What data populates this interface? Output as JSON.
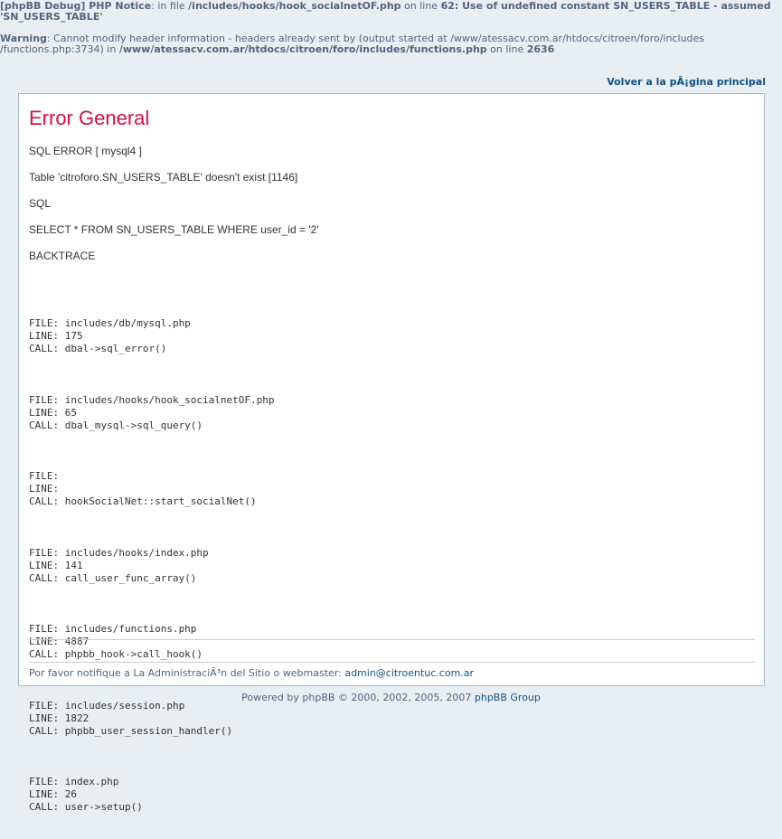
{
  "notices": {
    "debug_tag": "[phpBB Debug] PHP Notice",
    "notice1_text_a": ": in file ",
    "notice1_file": "/includes/hooks/hook_socialnetOF.php",
    "notice1_text_b": " on line ",
    "notice1_line": "62",
    "notice1_msg": ": Use of undefined constant SN_USERS_TABLE - assumed 'SN_USERS_TABLE'",
    "warning_tag": "Warning",
    "warning_text": ": Cannot modify header information - headers already sent by (output started at /www/atessacv.com.ar/htdocs/citroen/foro/includes /functions.php:3734) in ",
    "warning_file": "/www/atessacv.com.ar/htdocs/citroen/foro/includes/functions.php",
    "warning_text_b": " on line ",
    "warning_line": "2636"
  },
  "nav": {
    "home_link": "Volver a la pÃ¡gina principal"
  },
  "error": {
    "title": "Error General",
    "sql_error": "SQL ERROR [ mysql4 ]",
    "table_msg": "Table 'citroforo.SN_USERS_TABLE' doesn't exist [1146]",
    "sql_label": "SQL",
    "query": "SELECT * FROM SN_USERS_TABLE WHERE user_id = '2'",
    "backtrace_label": "BACKTRACE"
  },
  "backtrace": [
    {
      "file": "FILE: includes/db/mysql.php",
      "line": "LINE: 175",
      "call": "CALL: dbal->sql_error()"
    },
    {
      "file": "FILE: includes/hooks/hook_socialnetOF.php",
      "line": "LINE: 65",
      "call": "CALL: dbal_mysql->sql_query()"
    },
    {
      "file": "FILE:",
      "line": "LINE:",
      "call": "CALL: hookSocialNet::start_socialNet()"
    },
    {
      "file": "FILE: includes/hooks/index.php",
      "line": "LINE: 141",
      "call": "CALL: call_user_func_array()"
    },
    {
      "file": "FILE: includes/functions.php",
      "line": "LINE: 4887",
      "call": "CALL: phpbb_hook->call_hook()"
    },
    {
      "file": "FILE: includes/session.php",
      "line": "LINE: 1822",
      "call": "CALL: phpbb_user_session_handler()"
    },
    {
      "file": "FILE: index.php",
      "line": "LINE: 26",
      "call": "CALL: user->setup()"
    }
  ],
  "footer": {
    "notify_text": "Por favor notifique a La AdministraciÃ³n del Sitio o webmaster: ",
    "email": "admin@citroentuc.com.ar",
    "powered_a": "Powered by phpBB © 2000, 2002, 2005, 2007 ",
    "powered_link": "phpBB Group"
  }
}
